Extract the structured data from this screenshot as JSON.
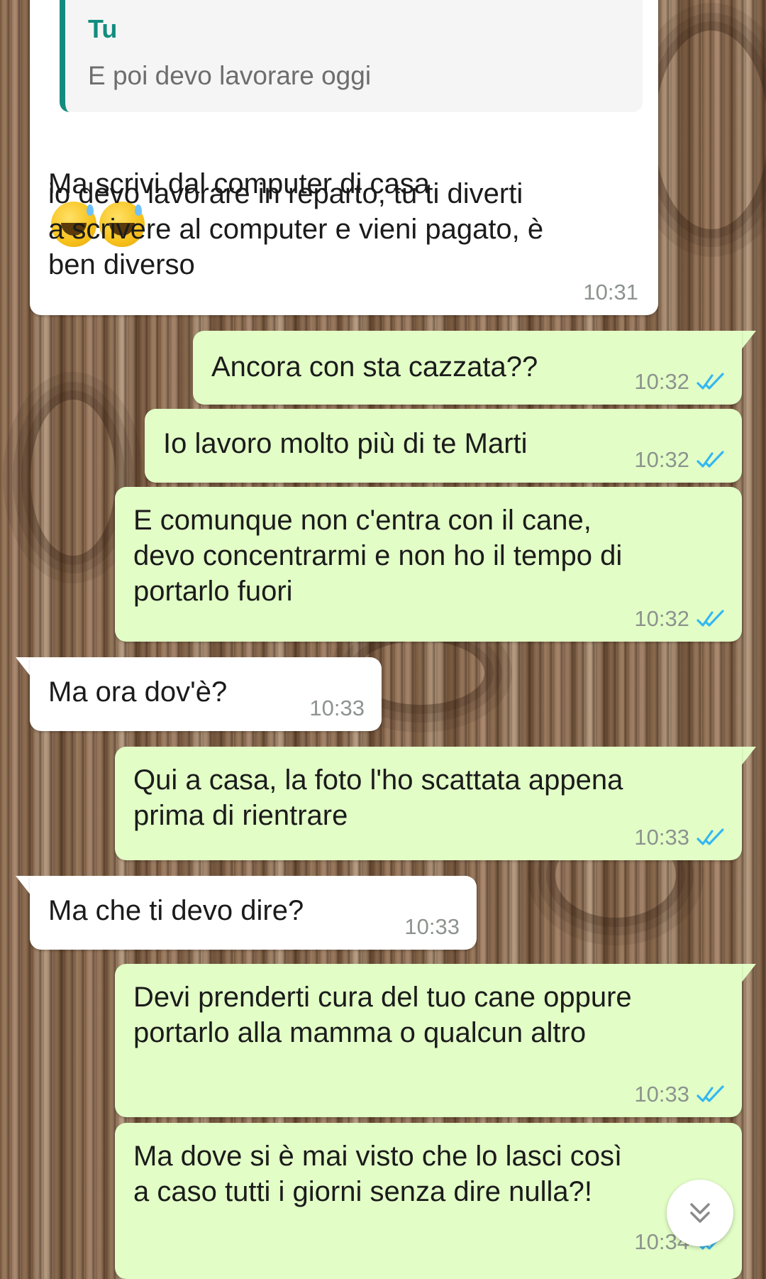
{
  "chat": {
    "quoted": {
      "author": "Tu",
      "text": "E poi devo lavorare oggi"
    },
    "messages": [
      {
        "direction": "in",
        "text": "Ma scrivi dal computer di casa",
        "text_cont": "io devo lavorare in reparto, tu ti diverti\na scrivere al computer e vieni pagato, è\nben diverso",
        "emojis": [
          "grinning-sweat-emoji",
          "grinning-sweat-emoji"
        ],
        "time": "10:31"
      },
      {
        "direction": "out",
        "text": "Ancora con sta cazzata??",
        "time": "10:32",
        "status": "read"
      },
      {
        "direction": "out",
        "text": "Io lavoro molto più di te Marti",
        "time": "10:32",
        "status": "read"
      },
      {
        "direction": "out",
        "text": "E comunque non c'entra con il cane,\ndevo concentrarmi e non ho il tempo di\nportarlo fuori",
        "time": "10:32",
        "status": "read"
      },
      {
        "direction": "in",
        "text": "Ma ora dov'è?",
        "time": "10:33"
      },
      {
        "direction": "out",
        "text": "Qui a casa, la foto l'ho scattata appena\nprima di rientrare",
        "time": "10:33",
        "status": "read"
      },
      {
        "direction": "in",
        "text": "Ma che ti devo dire?",
        "time": "10:33"
      },
      {
        "direction": "out",
        "text": "Devi prenderti cura del tuo cane oppure\nportarlo alla mamma o qualcun altro",
        "time": "10:33",
        "status": "read"
      },
      {
        "direction": "out",
        "text": "Ma dove si è mai visto che lo lasci così\na caso tutti i giorni senza dire nulla?!",
        "time": "10:34",
        "status": "read"
      }
    ]
  },
  "colors": {
    "incoming": "#ffffff",
    "outgoing": "#e2fec6",
    "read_ticks": "#34b7f1",
    "quote_accent": "#128c7e"
  },
  "icons": {
    "read_receipt": "double-check-icon",
    "scroll_down": "double-chevron-down-icon"
  }
}
